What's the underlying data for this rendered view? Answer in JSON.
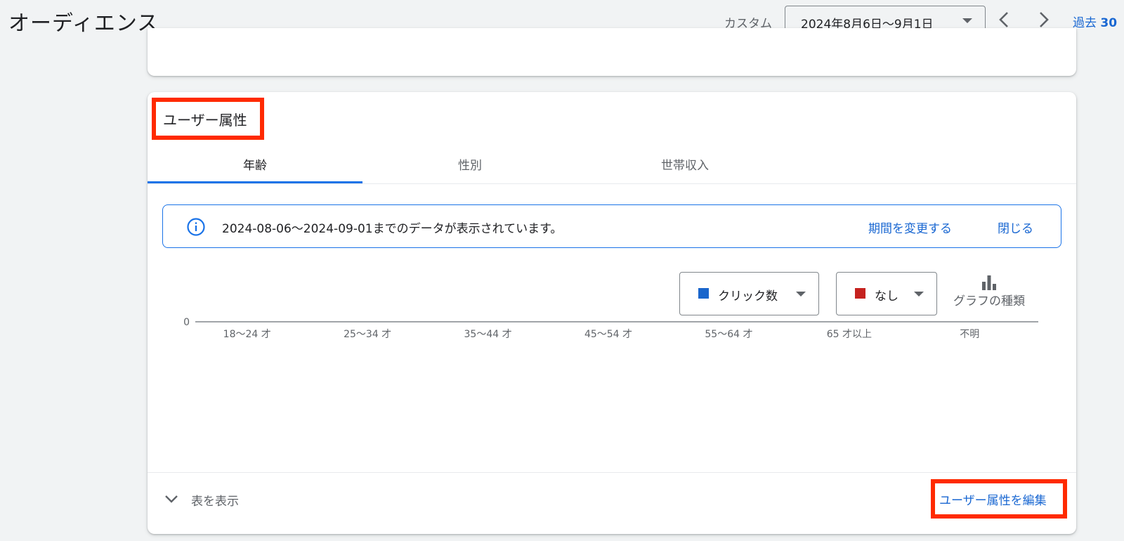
{
  "header": {
    "title": "オーディエンス",
    "custom_label": "カスタム",
    "date_range": "2024年8月6日〜9月1日",
    "prev_icon": "chevron-left-icon",
    "next_icon": "chevron-right-icon",
    "past_prefix": "過去",
    "past_value": "30"
  },
  "card": {
    "title": "ユーザー属性",
    "tabs": [
      {
        "label": "年齢"
      },
      {
        "label": "性別"
      },
      {
        "label": "世帯収入"
      }
    ],
    "active_tab": "年齢",
    "info": {
      "icon": "info-icon",
      "message": "2024-08-06〜2024-09-01までのデータが表示されています。",
      "change_period": "期間を変更する",
      "close": "閉じる"
    },
    "metric_primary": {
      "label": "クリック数",
      "color": "#1a66cc"
    },
    "metric_secondary": {
      "label": "なし",
      "color": "#c5221f"
    },
    "chart_type_label": "グラフの種類",
    "show_table": "表を表示",
    "edit_link": "ユーザー属性を編集"
  },
  "colors": {
    "accent": "#1a73e8",
    "highlight_box": "#ff2a00"
  },
  "chart_data": {
    "type": "bar",
    "categories": [
      "18〜24 才",
      "25〜34 才",
      "35〜44 才",
      "45〜54 才",
      "55〜64 才",
      "65 才以上",
      "不明"
    ],
    "series": [
      {
        "name": "クリック数",
        "values": [
          0,
          0,
          0,
          0,
          0,
          0,
          0
        ]
      }
    ],
    "yticks": [
      0,
      1,
      2
    ],
    "ylim": [
      0,
      2
    ],
    "grid": true,
    "title": "",
    "xlabel": "",
    "ylabel": ""
  }
}
